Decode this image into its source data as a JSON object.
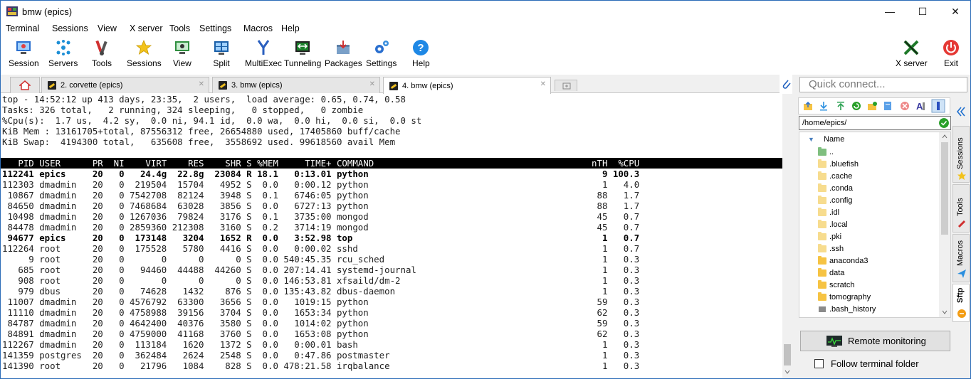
{
  "window": {
    "title": "bmw (epics)",
    "minimize": "—",
    "maximize": "☐",
    "close": "✕"
  },
  "menu": [
    "Terminal",
    "Sessions",
    "View",
    "X server",
    "Tools",
    "Settings",
    "Macros",
    "Help"
  ],
  "toolbar": {
    "items": [
      "Session",
      "Servers",
      "Tools",
      "Sessions",
      "View",
      "Split",
      "MultiExec",
      "Tunneling",
      "Packages",
      "Settings",
      "Help"
    ],
    "xserver": "X server",
    "exit": "Exit"
  },
  "tabs": [
    {
      "label": "2. corvette (epics)"
    },
    {
      "label": "3. bmw (epics)"
    },
    {
      "label": "4. bmw (epics)"
    }
  ],
  "terminal": {
    "lines": [
      "top - 14:52:12 up 413 days, 23:35,  2 users,  load average: 0.65, 0.74, 0.58",
      "Tasks: 326 total,   2 running, 324 sleeping,   0 stopped,   0 zombie",
      "%Cpu(s):  1.7 us,  4.2 sy,  0.0 ni, 94.1 id,  0.0 wa,  0.0 hi,  0.0 si,  0.0 st",
      "KiB Mem : 13161705+total, 87556312 free, 26654880 used, 17405860 buff/cache",
      "KiB Swap:  4194300 total,   635608 free,  3558692 used. 99618560 avail Mem",
      "",
      "   PID USER      PR  NI    VIRT    RES    SHR S %MEM     TIME+ COMMAND                                         nTH  %CPU",
      "112241 epics     20   0   24.4g  22.8g  23084 R 18.1   0:13.01 python                                            9 100.3",
      "112303 dmadmin   20   0  219504  15704   4952 S  0.0   0:00.12 python                                            1   4.0",
      " 10867 dmadmin   20   0 7542708  82124   3948 S  0.1   6746:05 python                                           88   1.7",
      " 84650 dmadmin   20   0 7468684  63028   3856 S  0.0   6727:13 python                                           88   1.7",
      " 10498 dmadmin   20   0 1267036  79824   3176 S  0.1   3735:00 mongod                                           45   0.7",
      " 84478 dmadmin   20   0 2859360 212308   3160 S  0.2   3714:19 mongod                                           45   0.7",
      " 94677 epics     20   0  173148   3204   1652 R  0.0   3:52.98 top                                               1   0.7",
      "112264 root      20   0  175528   5780   4416 S  0.0   0:00.02 sshd                                              1   0.7",
      "     9 root      20   0       0      0      0 S  0.0 540:45.35 rcu_sched                                         1   0.3",
      "   685 root      20   0   94460  44488  44260 S  0.0 207:14.41 systemd-journal                                   1   0.3",
      "   908 root      20   0       0      0      0 S  0.0 146:53.81 xfsaild/dm-2                                      1   0.3",
      "   979 dbus      20   0   74628   1432    876 S  0.0 135:43.82 dbus-daemon                                       1   0.3",
      " 11007 dmadmin   20   0 4576792  63300   3656 S  0.0   1019:15 python                                           59   0.3",
      " 11110 dmadmin   20   0 4758988  39156   3704 S  0.0   1653:34 python                                           62   0.3",
      " 84787 dmadmin   20   0 4642400  40376   3580 S  0.0   1014:02 python                                           59   0.3",
      " 84891 dmadmin   20   0 4759000  41168   3760 S  0.0   1653:08 python                                           62   0.3",
      "112267 dmadmin   20   0  113184   1620   1372 S  0.0   0:00.01 bash                                              1   0.3",
      "141359 postgres  20   0  362484   2624   2548 S  0.0   0:47.86 postmaster                                        1   0.3",
      "141390 root      20   0   21796   1084    828 S  0.0 478:21.58 irqbalance                                        1   0.3"
    ]
  },
  "sidebar": {
    "quick_connect_placeholder": "Quick connect...",
    "path": "/home/epics/",
    "column_name": "Name",
    "files": [
      "..",
      ".bluefish",
      ".cache",
      ".conda",
      ".config",
      ".idl",
      ".local",
      ".pki",
      ".ssh",
      "anaconda3",
      "data",
      "scratch",
      "tomography",
      ".bash_history"
    ],
    "remote_monitoring": "Remote monitoring",
    "follow_terminal": "Follow terminal folder",
    "vtabs": [
      "Sessions",
      "Tools",
      "Macros",
      "Sftp"
    ]
  }
}
